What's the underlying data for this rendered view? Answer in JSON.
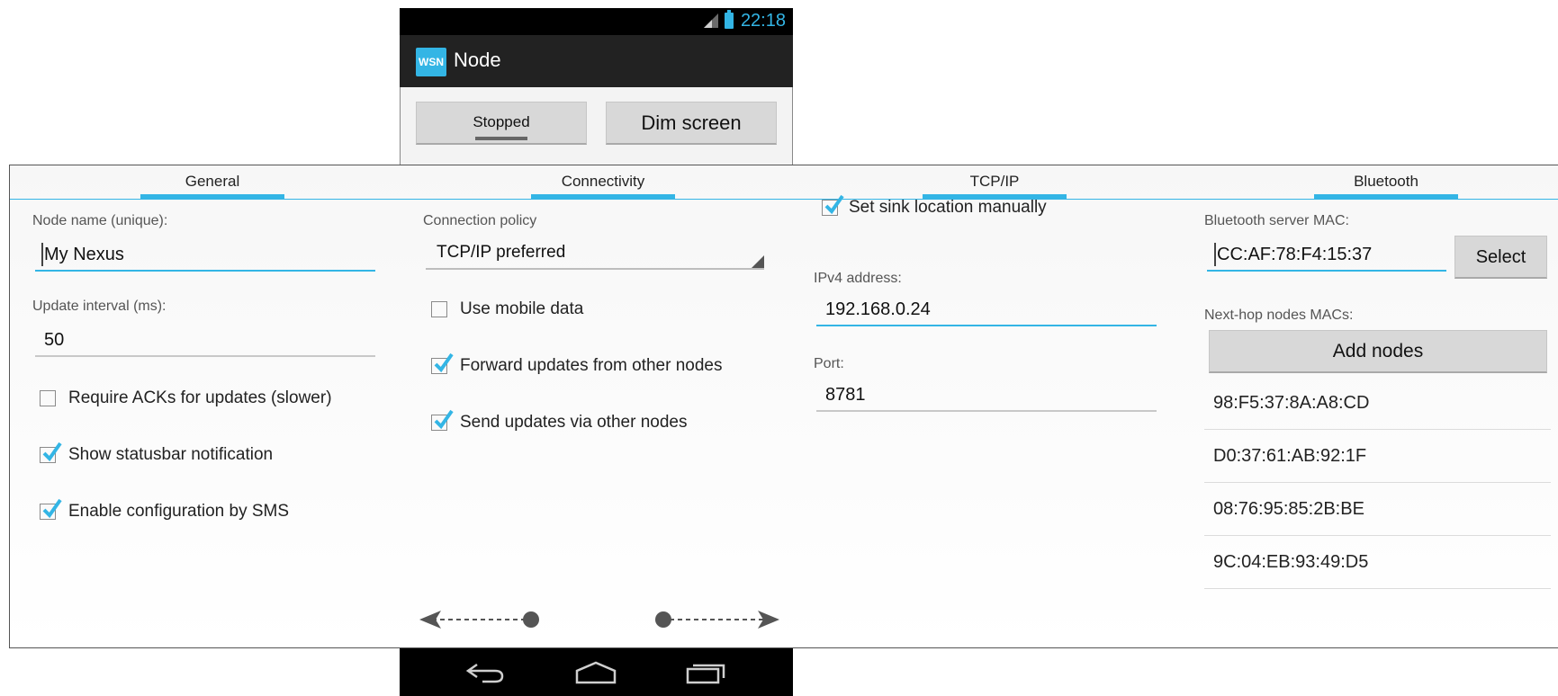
{
  "status_bar": {
    "time": "22:18",
    "signal_icon": "signal-icon",
    "battery_icon": "battery-icon"
  },
  "action_bar": {
    "app_icon_text": "WSN",
    "title": "Node"
  },
  "top_buttons": {
    "stopped_label": "Stopped",
    "dim_label": "Dim screen"
  },
  "tabs": [
    {
      "label": "General"
    },
    {
      "label": "Connectivity"
    },
    {
      "label": "TCP/IP"
    },
    {
      "label": "Bluetooth"
    }
  ],
  "general": {
    "node_name_label": "Node name (unique):",
    "node_name_value": "My Nexus",
    "update_interval_label": "Update interval (ms):",
    "update_interval_value": "50",
    "require_acks": {
      "label": "Require ACKs for updates (slower)",
      "checked": false
    },
    "show_statusbar": {
      "label": "Show statusbar notification",
      "checked": true
    },
    "enable_sms": {
      "label": "Enable configuration by SMS",
      "checked": true
    }
  },
  "connectivity": {
    "policy_label": "Connection policy",
    "policy_value": "TCP/IP preferred",
    "use_mobile": {
      "label": "Use mobile data",
      "checked": false
    },
    "forward_updates": {
      "label": "Forward updates from other nodes",
      "checked": true
    },
    "send_via": {
      "label": "Send updates via other nodes",
      "checked": true
    }
  },
  "tcpip": {
    "set_sink": {
      "label": "Set sink location manually",
      "checked": true
    },
    "ipv4_label": "IPv4 address:",
    "ipv4_value": "192.168.0.24",
    "port_label": "Port:",
    "port_value": "8781"
  },
  "bluetooth": {
    "server_mac_label": "Bluetooth server MAC:",
    "server_mac_value": "CC:AF:78:F4:15:37",
    "select_label": "Select",
    "next_hop_label": "Next-hop nodes MACs:",
    "add_nodes_label": "Add nodes",
    "macs": [
      "98:F5:37:8A:A8:CD",
      "D0:37:61:AB:92:1F",
      "08:76:95:85:2B:BE",
      "9C:04:EB:93:49:D5"
    ]
  },
  "swipe_hints": {
    "left": "swipe-left-arrow",
    "right": "swipe-right-arrow"
  },
  "nav_bar": {
    "back_icon": "back-icon",
    "home_icon": "home-icon",
    "recent_icon": "recent-apps-icon"
  },
  "colors": {
    "accent": "#33b5e5",
    "action_bar": "#222222",
    "status_bar": "#000000"
  }
}
